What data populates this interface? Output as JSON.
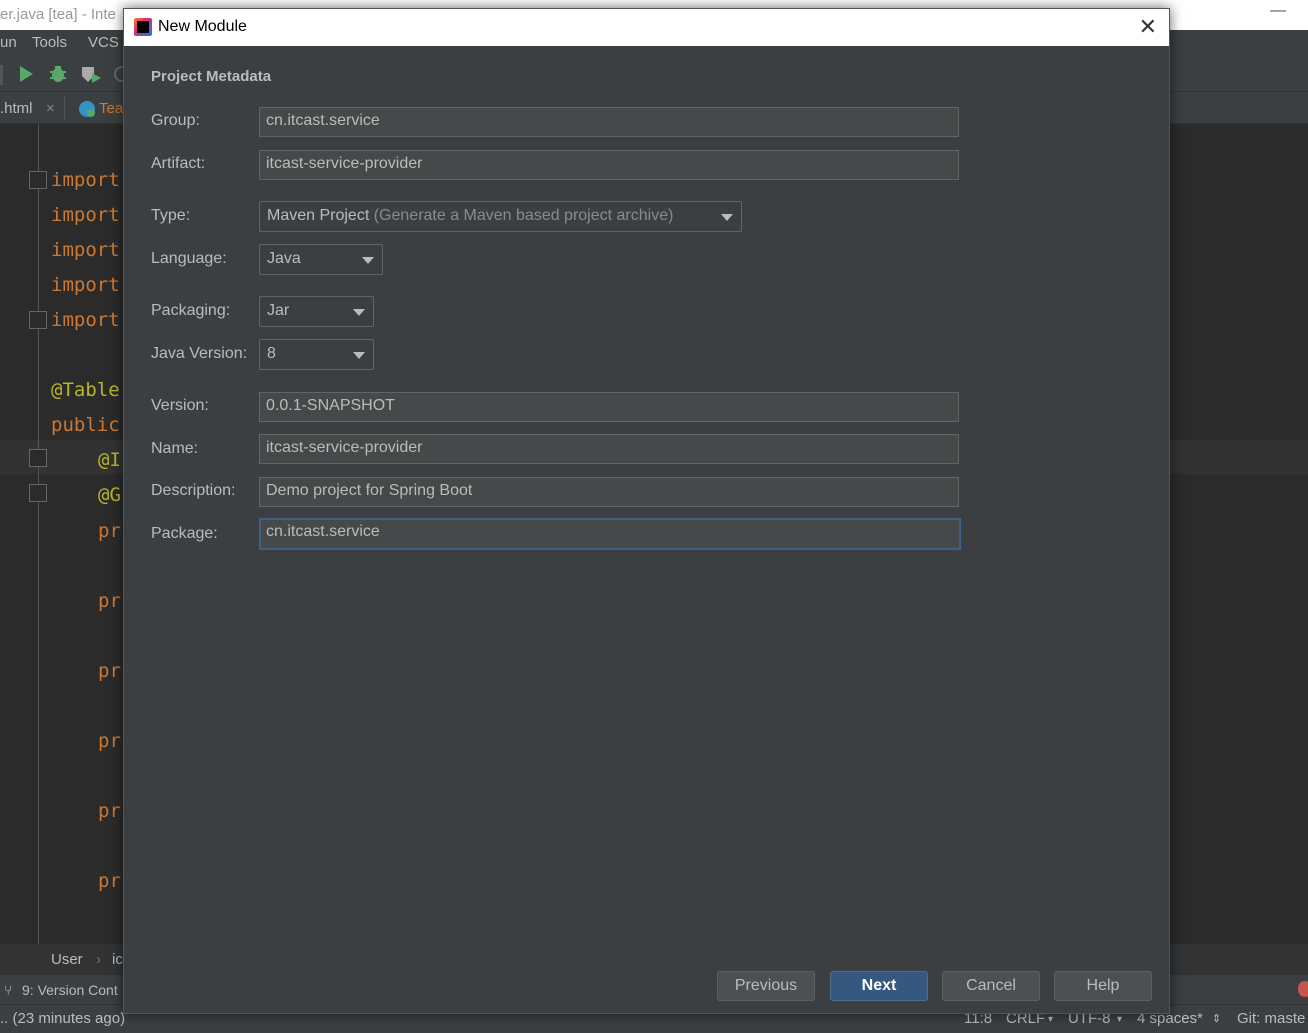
{
  "ide": {
    "window_title": "er.java [tea] - Inte",
    "menu": [
      "un",
      "Tools",
      "VCS"
    ],
    "tabs": [
      ".html",
      "Tea"
    ],
    "code_lines": [
      {
        "text": "import",
        "kind": "kw",
        "indent": 0
      },
      {
        "text": "import",
        "kind": "kw",
        "indent": 0
      },
      {
        "text": "import",
        "kind": "kw",
        "indent": 0
      },
      {
        "text": "import",
        "kind": "kw",
        "indent": 0
      },
      {
        "text": "import",
        "kind": "kw",
        "indent": 0
      },
      {
        "text": "@Table",
        "kind": "ann",
        "indent": 0
      },
      {
        "text": "public",
        "kind": "kw",
        "indent": 0
      },
      {
        "text": "@I",
        "kind": "ann",
        "indent": 1
      },
      {
        "text": "@G",
        "kind": "ann",
        "indent": 1
      },
      {
        "text": "pr",
        "kind": "kw",
        "indent": 1
      },
      {
        "text": "pr",
        "kind": "kw",
        "indent": 1
      },
      {
        "text": "pr",
        "kind": "kw",
        "indent": 1
      },
      {
        "text": "pr",
        "kind": "kw",
        "indent": 1
      },
      {
        "text": "pr",
        "kind": "kw",
        "indent": 1
      },
      {
        "text": "pr",
        "kind": "kw",
        "indent": 1
      }
    ],
    "breadcrumbs": [
      "User",
      "ic"
    ],
    "toolwindow": "9: Version Cont",
    "status": {
      "message": ".. (23 minutes ago)",
      "position": "11:8",
      "line_sep": "CRLF",
      "encoding": "UTF-8",
      "indent": "4 spaces*",
      "git": "Git: maste"
    }
  },
  "dialog": {
    "title": "New Module",
    "section": "Project Metadata",
    "fields": {
      "group": {
        "label": "Group:",
        "value": "cn.itcast.service"
      },
      "artifact": {
        "label": "Artifact:",
        "value": "itcast-service-provider"
      },
      "type": {
        "label": "Type:",
        "value": "Maven Project",
        "hint": "(Generate a Maven based project archive)"
      },
      "language": {
        "label": "Language:",
        "value": "Java"
      },
      "packaging": {
        "label": "Packaging:",
        "value": "Jar"
      },
      "java_version": {
        "label": "Java Version:",
        "value": "8"
      },
      "version": {
        "label": "Version:",
        "value": "0.0.1-SNAPSHOT"
      },
      "name": {
        "label": "Name:",
        "value": "itcast-service-provider"
      },
      "description": {
        "label": "Description:",
        "value": "Demo project for Spring Boot"
      },
      "package": {
        "label": "Package:",
        "value": "cn.itcast.service"
      }
    },
    "buttons": {
      "previous": "Previous",
      "next": "Next",
      "cancel": "Cancel",
      "help": "Help"
    }
  },
  "colors": {
    "dialog_bg": "#3c3f41",
    "primary_button": "#365880",
    "focus_border": "#3d6185",
    "keyword": "#cc7832",
    "annotation": "#bbb529"
  }
}
